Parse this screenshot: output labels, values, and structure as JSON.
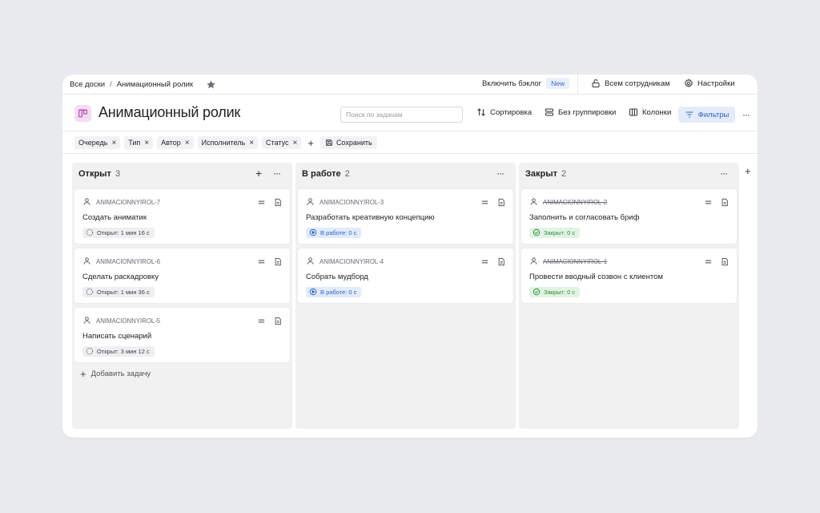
{
  "topbar": {
    "breadcrumb_root": "Все доски",
    "breadcrumb_sep": "/",
    "breadcrumb_current": "Анимационный ролик",
    "backlog_label": "Включить бэклог",
    "new_badge": "New",
    "share_label": "Всем сотрудникам",
    "settings_label": "Настройки"
  },
  "header": {
    "title": "Анимационный ролик",
    "search_placeholder": "Поиск по задачам",
    "sort_label": "Сортировка",
    "group_label": "Без группировки",
    "columns_label": "Колонки",
    "filters_label": "Фильтры",
    "more": "···"
  },
  "chips": [
    "Очередь",
    "Тип",
    "Автор",
    "Исполнитель",
    "Статус"
  ],
  "chip_close": "×",
  "save_label": "Сохранить",
  "add_task_label": "Добавить задачу",
  "columns": [
    {
      "title": "Открыт",
      "count": "3",
      "cards": [
        {
          "key": "ANIMACIONNYIROL-7",
          "name": "Создать аниматик",
          "status": "Открыт: 1 мин 16 с"
        },
        {
          "key": "ANIMACIONNYIROL-6",
          "name": "Сделать раскадровку",
          "status": "Открыт: 1 мин 36 с"
        },
        {
          "key": "ANIMACIONNYIROL-5",
          "name": "Написать сценарий",
          "status": "Открыт: 3 мин 12 с"
        }
      ]
    },
    {
      "title": "В работе",
      "count": "2",
      "cards": [
        {
          "key": "ANIMACIONNYIROL-3",
          "name": "Разработать креативную концепцию",
          "status": "В работе: 0 с"
        },
        {
          "key": "ANIMACIONNYIROL-4",
          "name": "Собрать мудборд",
          "status": "В работе: 0 с"
        }
      ]
    },
    {
      "title": "Закрыт",
      "count": "2",
      "cards": [
        {
          "key": "ANIMACIONNYIROL-2",
          "name": "Заполнить и согласовать бриф",
          "status": "Закрыт: 0 с"
        },
        {
          "key": "ANIMACIONNYIROL-1",
          "name": "Провести вводный созвон с клиентом",
          "status": "Закрыт: 0 с"
        }
      ]
    }
  ],
  "colors": {
    "accent": "#2d63c8",
    "open_status": "#3a3c40",
    "work_status": "#2d63c8",
    "done_status": "#2e8a3c",
    "board_icon": "#c23fb9"
  }
}
